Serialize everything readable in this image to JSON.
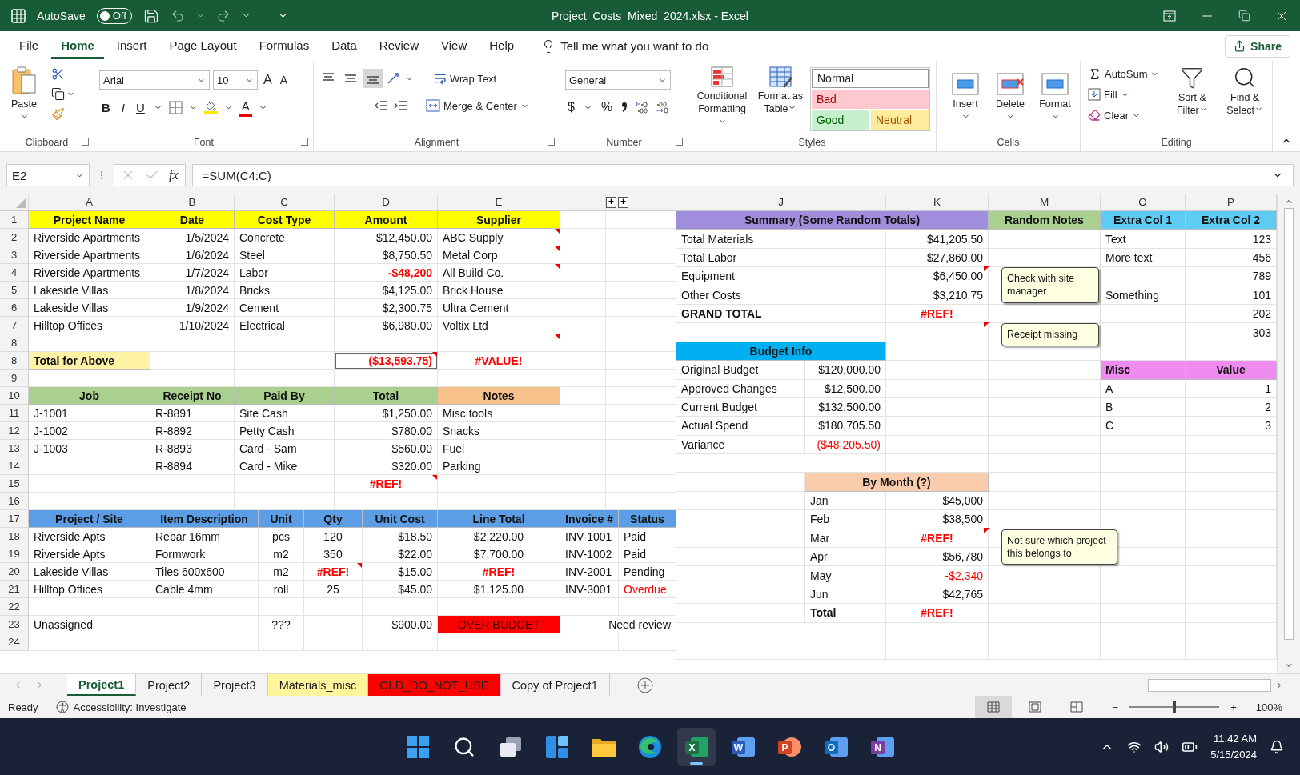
{
  "window": {
    "title": "Project_Costs_Mixed_2024.xlsx  -  Excel",
    "autosave": "AutoSave",
    "autosave_state": "Off",
    "autosave_on": false
  },
  "ribbon_tabs": [
    {
      "label": "File",
      "selected": false
    },
    {
      "label": "Home",
      "selected": true
    },
    {
      "label": "Insert",
      "selected": false
    },
    {
      "label": "Page Layout",
      "selected": false
    },
    {
      "label": "Formulas",
      "selected": false
    },
    {
      "label": "Data",
      "selected": false
    },
    {
      "label": "Review",
      "selected": false
    },
    {
      "label": "View",
      "selected": false
    },
    {
      "label": "Help",
      "selected": false
    }
  ],
  "tell_me": "Tell me what you want to do",
  "share": "Share",
  "ribbon": {
    "clipboard": {
      "label": "Clipboard",
      "paste": "Paste"
    },
    "font": {
      "label": "Font",
      "name": "Arial",
      "size": "10",
      "grow": "A",
      "shrink": "A",
      "bold": "B",
      "italic": "I",
      "underline": "U",
      "font_color": "A"
    },
    "alignment": {
      "label": "Alignment",
      "valign": [
        {
          "selected": false
        },
        {
          "selected": false
        },
        {
          "selected": true
        }
      ],
      "wrap": "Wrap Text",
      "merge": "Merge & Center"
    },
    "number": {
      "label": "Number",
      "format": "General",
      "currency": "$",
      "percent": "%"
    },
    "styles": {
      "label": "Styles",
      "conditional": "Conditional Formatting",
      "table": "Format as Table",
      "gallery": [
        {
          "text": "Normal",
          "kind": "normal"
        },
        {
          "text": "Bad",
          "kind": "bad"
        },
        {
          "text": "Good",
          "kind": "good"
        },
        {
          "text": "Neutral",
          "kind": "neutral"
        }
      ]
    },
    "cells": {
      "label": "Cells",
      "buttons": [
        {
          "text": "Insert",
          "kind": "insert"
        },
        {
          "text": "Delete",
          "kind": "delete"
        },
        {
          "text": "Format",
          "kind": "format"
        }
      ]
    },
    "editing": {
      "label": "Editing",
      "autosum": "AutoSum",
      "fill": "Fill",
      "clear": "Clear",
      "sort": "Sort & Filter",
      "find": "Find & Select"
    }
  },
  "formula_bar": {
    "name_box": "E2",
    "fx": "fx",
    "formula": "=SUM(C4:C)"
  },
  "left_columns": [
    "A",
    "B",
    "C",
    "D",
    "E"
  ],
  "hidden_column_buttons": [
    "+",
    "+"
  ],
  "left_rows": [
    {
      "label": "1",
      "kind": "main",
      "cells": [
        {
          "text": "Project Name",
          "kind": "header",
          "color": "#ffff00"
        },
        {
          "text": "Date",
          "kind": "header",
          "color": "#ffff00"
        },
        {
          "text": "Cost Type",
          "kind": "header",
          "color": "#ffff00"
        },
        {
          "text": "Amount",
          "kind": "header",
          "color": "#ffff00"
        },
        {
          "text": "Supplier",
          "kind": "header",
          "color": "#ffff00"
        },
        null,
        null
      ]
    },
    {
      "label": "2",
      "kind": "main",
      "cells": [
        {
          "text": "Riverside Apartments",
          "kind": "text"
        },
        {
          "text": "1/5/2024",
          "kind": "number"
        },
        {
          "text": "Concrete",
          "kind": "text"
        },
        {
          "text": "$12,450.00",
          "kind": "number"
        },
        {
          "text": "ABC Supply",
          "kind": "text",
          "flag": true
        },
        null,
        null
      ]
    },
    {
      "label": "3",
      "kind": "main",
      "cells": [
        {
          "text": "Riverside Apartments",
          "kind": "text"
        },
        {
          "text": "1/6/2024",
          "kind": "number"
        },
        {
          "text": "Steel",
          "kind": "text"
        },
        {
          "text": "$8,750.50",
          "kind": "number"
        },
        {
          "text": "Metal Corp",
          "kind": "text",
          "flag": true
        },
        null,
        null
      ]
    },
    {
      "label": "4",
      "kind": "main",
      "cells": [
        {
          "text": "Riverside Apartments",
          "kind": "text"
        },
        {
          "text": "1/7/2024",
          "kind": "number"
        },
        {
          "text": "Labor",
          "kind": "text"
        },
        {
          "text": "-$48,200",
          "kind": "number_error"
        },
        {
          "text": "All Build Co.",
          "kind": "text",
          "flag": true
        },
        null,
        null
      ]
    },
    {
      "label": "5",
      "kind": "main",
      "cells": [
        {
          "text": "Lakeside Villas",
          "kind": "text"
        },
        {
          "text": "1/8/2024",
          "kind": "number"
        },
        {
          "text": "Bricks",
          "kind": "text"
        },
        {
          "text": "$4,125.00",
          "kind": "number"
        },
        {
          "text": "Brick House",
          "kind": "text"
        },
        null,
        null
      ]
    },
    {
      "label": "6",
      "kind": "main",
      "cells": [
        {
          "text": "Lakeside Villas",
          "kind": "text"
        },
        {
          "text": "1/9/2024",
          "kind": "number"
        },
        {
          "text": "Cement",
          "kind": "text"
        },
        {
          "text": "$2,300.75",
          "kind": "number"
        },
        {
          "text": "Ultra Cement",
          "kind": "text"
        },
        null,
        null
      ]
    },
    {
      "label": "7",
      "kind": "main",
      "cells": [
        {
          "text": "Hilltop Offices",
          "kind": "text"
        },
        {
          "text": "1/10/2024",
          "kind": "number"
        },
        {
          "text": "Electrical",
          "kind": "text"
        },
        {
          "text": "$6,980.00",
          "kind": "number"
        },
        {
          "text": "Voltix Ltd",
          "kind": "text"
        },
        null,
        null
      ]
    },
    {
      "label": "8",
      "kind": "main",
      "cells": [
        null,
        null,
        null,
        null,
        {
          "kind": "text",
          "flag": true
        },
        null,
        null
      ]
    },
    {
      "label": "8",
      "kind": "main",
      "cells": [
        {
          "text": "Total for Above",
          "kind": "text_bold",
          "color": "#fff3a6"
        },
        null,
        null,
        {
          "text": "($13,593.75)",
          "kind": "boxed_error",
          "flag": true
        },
        {
          "text": "#VALUE!",
          "kind": "error"
        },
        null,
        null
      ]
    },
    {
      "label": "9",
      "kind": "main"
    },
    {
      "label": "10",
      "kind": "main",
      "cells": [
        {
          "text": "Job",
          "kind": "header",
          "color": "#a9d08e"
        },
        {
          "text": "Receipt No",
          "kind": "header",
          "color": "#a9d08e"
        },
        {
          "text": "Paid By",
          "kind": "header",
          "color": "#a9d08e"
        },
        {
          "text": "Total",
          "kind": "header",
          "color": "#a9d08e"
        },
        {
          "text": "Notes",
          "kind": "header",
          "color": "#f8c08a"
        },
        null,
        null
      ]
    },
    {
      "label": "11",
      "kind": "main",
      "cells": [
        {
          "text": "J-1001",
          "kind": "text"
        },
        {
          "text": "R-8891",
          "kind": "text"
        },
        {
          "text": "Site Cash",
          "kind": "text"
        },
        {
          "text": "$1,250.00",
          "kind": "number"
        },
        {
          "text": "Misc tools",
          "kind": "text"
        },
        null,
        null
      ]
    },
    {
      "label": "12",
      "kind": "main",
      "cells": [
        {
          "text": "J-1002",
          "kind": "text"
        },
        {
          "text": "R-8892",
          "kind": "text"
        },
        {
          "text": "Petty Cash",
          "kind": "text"
        },
        {
          "text": "$780.00",
          "kind": "number"
        },
        {
          "text": "Snacks",
          "kind": "text"
        },
        null,
        null
      ]
    },
    {
      "label": "13",
      "kind": "main",
      "cells": [
        {
          "text": "J-1003",
          "kind": "text"
        },
        {
          "text": "R-8893",
          "kind": "text"
        },
        {
          "text": "Card - Sam",
          "kind": "text"
        },
        {
          "text": "$560.00",
          "kind": "number"
        },
        {
          "text": "Fuel",
          "kind": "text"
        },
        null,
        null
      ]
    },
    {
      "label": "14",
      "kind": "main",
      "cells": [
        null,
        {
          "text": "R-8894",
          "kind": "text"
        },
        {
          "text": "Card - Mike",
          "kind": "text"
        },
        {
          "text": "$320.00",
          "kind": "number"
        },
        {
          "text": "Parking",
          "kind": "text"
        },
        null,
        null
      ]
    },
    {
      "label": "15",
      "kind": "main",
      "cells": [
        null,
        null,
        null,
        {
          "text": "#REF!",
          "kind": "error",
          "flag": true
        },
        null,
        null,
        null
      ]
    },
    {
      "label": "16",
      "kind": "main"
    },
    {
      "label": "17",
      "kind": "items",
      "cells": [
        {
          "text": "Project / Site",
          "kind": "header",
          "color": "#5b9ee6"
        },
        {
          "text": "Item Description",
          "kind": "header",
          "color": "#5b9ee6"
        },
        {
          "text": "Unit",
          "kind": "header",
          "color": "#5b9ee6"
        },
        {
          "text": "Qty",
          "kind": "header",
          "color": "#5b9ee6"
        },
        {
          "text": "Unit Cost",
          "kind": "header",
          "color": "#5b9ee6"
        },
        {
          "text": "Line Total",
          "kind": "header",
          "color": "#5b9ee6"
        },
        {
          "text": "Invoice #",
          "kind": "header",
          "color": "#5b9ee6"
        },
        {
          "text": "Status",
          "kind": "header",
          "color": "#5b9ee6"
        }
      ]
    },
    {
      "label": "18",
      "kind": "items",
      "cells": [
        {
          "text": "Riverside Apts",
          "kind": "text"
        },
        {
          "text": "Rebar 16mm",
          "kind": "text"
        },
        {
          "text": "pcs",
          "kind": "center"
        },
        {
          "text": "120",
          "kind": "center"
        },
        {
          "text": "$18.50",
          "kind": "number"
        },
        {
          "text": "$2,220.00",
          "kind": "center"
        },
        {
          "text": "INV-1001",
          "kind": "text"
        },
        {
          "text": "Paid",
          "kind": "text"
        }
      ]
    },
    {
      "label": "19",
      "kind": "items",
      "cells": [
        {
          "text": "Riverside Apts",
          "kind": "text"
        },
        {
          "text": "Formwork",
          "kind": "text"
        },
        {
          "text": "m2",
          "kind": "center"
        },
        {
          "text": "350",
          "kind": "center"
        },
        {
          "text": "$22.00",
          "kind": "number"
        },
        {
          "text": "$7,700.00",
          "kind": "center"
        },
        {
          "text": "INV-1002",
          "kind": "text"
        },
        {
          "text": "Paid",
          "kind": "text"
        }
      ]
    },
    {
      "label": "20",
      "kind": "items",
      "cells": [
        {
          "text": "Lakeside Villas",
          "kind": "text"
        },
        {
          "text": "Tiles 600x600",
          "kind": "text"
        },
        {
          "text": "m2",
          "kind": "center"
        },
        {
          "text": "#REF!",
          "kind": "error",
          "flag": true
        },
        {
          "text": "$15.00",
          "kind": "number"
        },
        {
          "text": "#REF!",
          "kind": "error"
        },
        {
          "text": "INV-2001",
          "kind": "text"
        },
        {
          "text": "Pending",
          "kind": "text"
        }
      ]
    },
    {
      "label": "21",
      "kind": "items",
      "cells": [
        {
          "text": "Hilltop Offices",
          "kind": "text"
        },
        {
          "text": "Cable 4mm",
          "kind": "text"
        },
        {
          "text": "roll",
          "kind": "center"
        },
        {
          "text": "25",
          "kind": "center"
        },
        {
          "text": "$45.00",
          "kind": "number"
        },
        {
          "text": "$1,125.00",
          "kind": "center"
        },
        {
          "text": "INV-3001",
          "kind": "text"
        },
        {
          "text": "Overdue",
          "kind": "text_alert"
        }
      ]
    },
    {
      "label": "22",
      "kind": "items"
    },
    {
      "label": "23",
      "kind": "items_merged",
      "cells": [
        {
          "text": "Unassigned",
          "kind": "text"
        },
        null,
        {
          "text": "???",
          "kind": "center"
        },
        null,
        {
          "text": "$900.00",
          "kind": "number"
        },
        {
          "text": "OVER BUDGET",
          "kind": "alert",
          "color": "#ff0000"
        },
        {
          "text": "Need review",
          "kind": "number"
        }
      ]
    },
    {
      "label": "24",
      "kind": "items"
    }
  ],
  "right_columns": [
    "J",
    "K",
    "M",
    "O",
    "P"
  ],
  "right_rows": [
    {
      "kind": "title",
      "cells": [
        {
          "text": "Summary (Some Random Totals)",
          "kind": "header",
          "color": "#a08ddb"
        },
        {
          "text": "Random Notes",
          "kind": "header",
          "color": "#a9d08e"
        },
        {
          "text": "Extra Col 1",
          "kind": "header",
          "color": "#5fcbf2"
        },
        {
          "text": "Extra Col 2",
          "kind": "header",
          "color": "#5fcbf2"
        }
      ]
    },
    {
      "kind": "summary",
      "cells": [
        {
          "text": "Total Materials",
          "kind": "text"
        },
        {
          "text": "$41,205.50",
          "kind": "number"
        },
        null,
        {
          "text": "Text",
          "kind": "text"
        },
        {
          "text": "123",
          "kind": "number"
        }
      ]
    },
    {
      "kind": "summary",
      "cells": [
        {
          "text": "Total Labor",
          "kind": "text"
        },
        {
          "text": "$27,860.00",
          "kind": "number"
        },
        null,
        {
          "text": "More text",
          "kind": "text"
        },
        {
          "text": "456",
          "kind": "number"
        }
      ]
    },
    {
      "kind": "summary",
      "cells": [
        {
          "text": "Equipment",
          "kind": "text"
        },
        {
          "text": "$6,450.00",
          "kind": "number"
        },
        {
          "kind": "text",
          "comment": "Check with site manager"
        },
        null,
        {
          "text": "789",
          "kind": "number"
        }
      ]
    },
    {
      "kind": "summary",
      "cells": [
        {
          "text": "Other Costs",
          "kind": "text"
        },
        {
          "text": "$3,210.75",
          "kind": "number"
        },
        null,
        {
          "text": "Something",
          "kind": "text"
        },
        {
          "text": "101",
          "kind": "number"
        }
      ]
    },
    {
      "kind": "summary",
      "cells": [
        {
          "text": "GRAND TOTAL",
          "kind": "text_bold"
        },
        {
          "text": "#REF!",
          "kind": "error"
        },
        null,
        null,
        {
          "text": "202",
          "kind": "number"
        }
      ]
    },
    {
      "kind": "summary",
      "cells": [
        null,
        null,
        {
          "kind": "text",
          "comment": "Receipt missing"
        },
        null,
        {
          "text": "303",
          "kind": "number"
        }
      ]
    },
    {
      "kind": "summary",
      "cells": [
        {
          "text": "Budget Info",
          "kind": "header",
          "color": "#00b0f0"
        },
        null,
        null,
        null,
        null
      ]
    },
    {
      "kind": "budget",
      "cells": [
        {
          "text": "Original Budget",
          "kind": "text"
        },
        {
          "text": "$120,000.00",
          "kind": "number"
        },
        null,
        null,
        {
          "text": "Misc",
          "kind": "header_left",
          "color": "#f08cef"
        },
        {
          "text": "Value",
          "kind": "header",
          "color": "#f08cef"
        }
      ]
    },
    {
      "kind": "budget",
      "cells": [
        {
          "text": "Approved Changes",
          "kind": "text"
        },
        {
          "text": "$12,500.00",
          "kind": "number"
        },
        null,
        null,
        {
          "text": "A",
          "kind": "text"
        },
        {
          "text": "1",
          "kind": "number"
        }
      ]
    },
    {
      "kind": "budget",
      "cells": [
        {
          "text": "Current Budget",
          "kind": "text"
        },
        {
          "text": "$132,500.00",
          "kind": "number"
        },
        null,
        null,
        {
          "text": "B",
          "kind": "text"
        },
        {
          "text": "2",
          "kind": "number"
        }
      ]
    },
    {
      "kind": "budget",
      "cells": [
        {
          "text": "Actual Spend",
          "kind": "text"
        },
        {
          "text": "$180,705.50",
          "kind": "number"
        },
        null,
        null,
        {
          "text": "C",
          "kind": "text"
        },
        {
          "text": "3",
          "kind": "number"
        }
      ]
    },
    {
      "kind": "budget",
      "cells": [
        {
          "text": "Variance",
          "kind": "text"
        },
        {
          "text": "($48,205.50)",
          "kind": "number_alert"
        },
        null,
        null,
        null,
        null
      ]
    },
    {
      "kind": "summary"
    },
    {
      "kind": "month_head",
      "cells": [
        null,
        {
          "text": "By Month (?)",
          "kind": "header",
          "color": "#f8cbad"
        },
        null,
        null,
        null
      ]
    },
    {
      "kind": "budget",
      "cells": [
        null,
        {
          "text": "Jan",
          "kind": "text"
        },
        {
          "text": "$45,000",
          "kind": "number"
        },
        null,
        null,
        null
      ]
    },
    {
      "kind": "budget",
      "cells": [
        null,
        {
          "text": "Feb",
          "kind": "text"
        },
        {
          "text": "$38,500",
          "kind": "number"
        },
        null,
        null,
        null
      ]
    },
    {
      "kind": "budget",
      "cells": [
        null,
        {
          "text": "Mar",
          "kind": "text"
        },
        {
          "text": "#REF!",
          "kind": "error"
        },
        {
          "kind": "text",
          "comment": "Not sure which project this belongs to"
        },
        null,
        null
      ]
    },
    {
      "kind": "budget",
      "cells": [
        null,
        {
          "text": "Apr",
          "kind": "text"
        },
        {
          "text": "$56,780",
          "kind": "number"
        },
        null,
        null,
        null
      ]
    },
    {
      "kind": "budget",
      "cells": [
        null,
        {
          "text": "May",
          "kind": "text"
        },
        {
          "text": "-$2,340",
          "kind": "number_alert"
        },
        null,
        null,
        null
      ]
    },
    {
      "kind": "budget",
      "cells": [
        null,
        {
          "text": "Jun",
          "kind": "text"
        },
        {
          "text": "$42,765",
          "kind": "number"
        },
        null,
        null,
        null
      ]
    },
    {
      "kind": "budget",
      "cells": [
        null,
        {
          "text": "Total",
          "kind": "text_bold"
        },
        {
          "text": "#REF!",
          "kind": "error"
        },
        null,
        null,
        null
      ]
    },
    {
      "kind": "summary"
    },
    {
      "kind": "summary"
    }
  ],
  "sheet_tabs": [
    {
      "label": "Project1",
      "selected": true
    },
    {
      "label": "Project2",
      "selected": false
    },
    {
      "label": "Project3",
      "selected": false
    },
    {
      "label": "Materials_misc",
      "selected": false,
      "color": "#fff59d"
    },
    {
      "label": "OLD_DO_NOT_USE",
      "selected": false,
      "color": "#ff0000"
    },
    {
      "label": "Copy of Project1",
      "selected": false
    }
  ],
  "status_bar": {
    "ready": "Ready",
    "accessibility": "Accessibility: Investigate",
    "views": [
      {
        "kind": "normal",
        "selected": true
      },
      {
        "kind": "page_layout",
        "selected": false
      },
      {
        "kind": "page_break",
        "selected": false
      }
    ],
    "zoom_out": "−",
    "zoom_in": "+",
    "zoom": {
      "level": 0.5
    },
    "zoom_text": "100%"
  },
  "taskbar": {
    "apps": [
      {
        "kind": "start",
        "selected": false
      },
      {
        "kind": "search",
        "selected": false
      },
      {
        "kind": "taskview",
        "selected": false
      },
      {
        "kind": "widgets",
        "selected": false
      },
      {
        "kind": "explorer",
        "selected": false
      },
      {
        "kind": "edge",
        "selected": false
      },
      {
        "kind": "excel",
        "letter": "X",
        "selected": true
      },
      {
        "kind": "word",
        "letter": "W",
        "selected": false
      },
      {
        "kind": "powerpoint",
        "letter": "P",
        "selected": false
      },
      {
        "kind": "outlook",
        "letter": "O",
        "selected": false
      },
      {
        "kind": "onenote",
        "letter": "N",
        "selected": false
      }
    ],
    "time": "11:42 AM",
    "date": "5/15/2024"
  }
}
